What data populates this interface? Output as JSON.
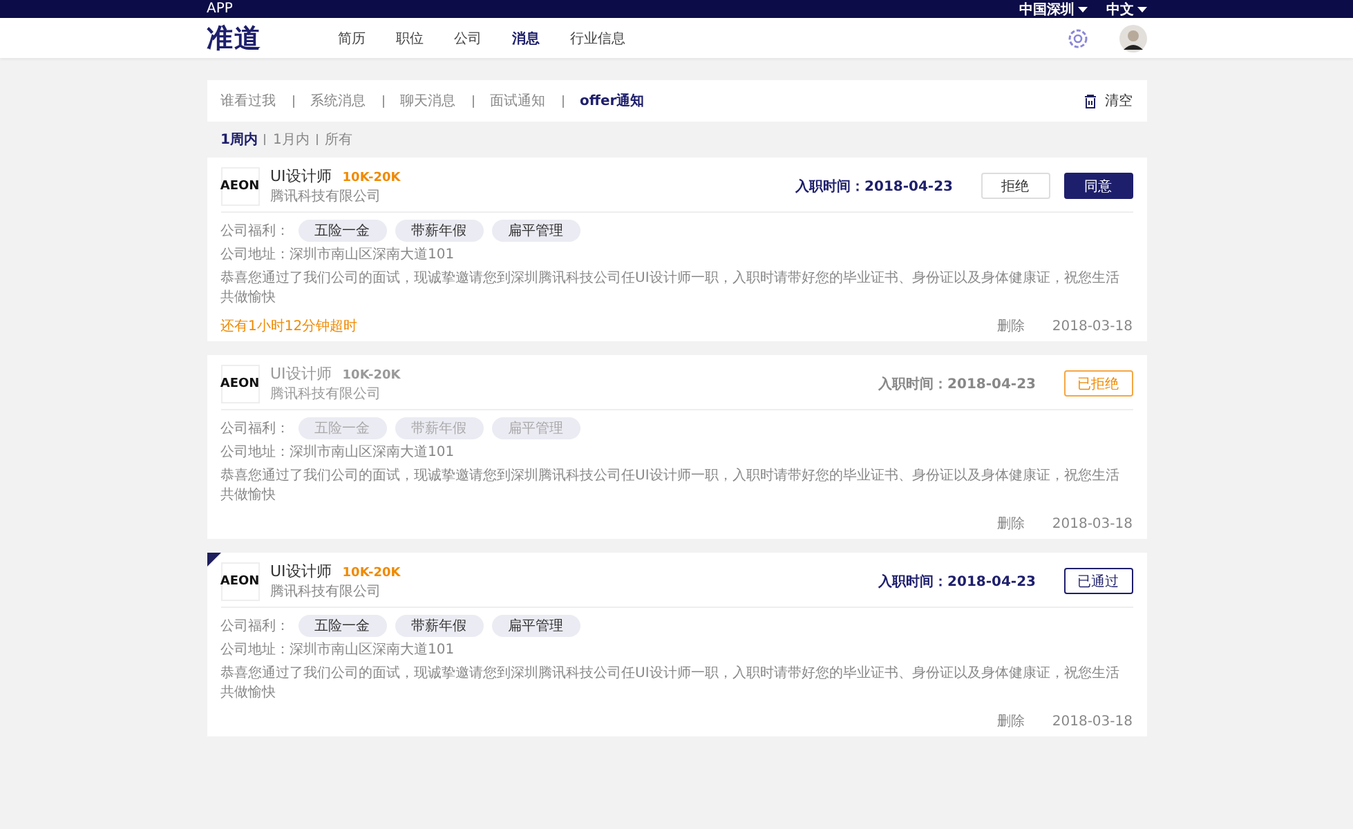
{
  "top_bar": {
    "app_label": "APP",
    "location": "中国深圳",
    "language": "中文"
  },
  "header": {
    "logo": "准道",
    "nav": [
      {
        "label": "简历",
        "selected": false
      },
      {
        "label": "职位",
        "selected": false
      },
      {
        "label": "公司",
        "selected": false
      },
      {
        "label": "消息",
        "selected": true
      },
      {
        "label": "行业信息",
        "selected": false
      }
    ]
  },
  "message_tabs": [
    {
      "label": "谁看过我",
      "selected": false
    },
    {
      "label": "系统消息",
      "selected": false
    },
    {
      "label": "聊天消息",
      "selected": false
    },
    {
      "label": "面试通知",
      "selected": false
    },
    {
      "label": "offer通知",
      "selected": true
    }
  ],
  "clear_label": "清空",
  "time_filters": [
    {
      "label": "1周内",
      "selected": true
    },
    {
      "label": "1月内",
      "selected": false
    },
    {
      "label": "所有",
      "selected": false
    }
  ],
  "offers": [
    {
      "logo": "AEON",
      "title": "UI设计师",
      "salary": "10K-20K",
      "company": "腾讯科技有限公司",
      "start_date": "入职时间：2018-04-23",
      "faded": false,
      "flagged": false,
      "kind": "pending",
      "actions": [
        "拒绝",
        "同意"
      ],
      "benefits_label": "公司福利：",
      "benefits": [
        "五险一金",
        "带薪年假",
        "扁平管理"
      ],
      "address": "公司地址：深圳市南山区深南大道101",
      "message": "恭喜您通过了我们公司的面试，现诚挚邀请您到深圳腾讯科技公司任UI设计师一职，入职时请带好您的毕业证书、身份证以及身体健康证，祝您生活共做愉快",
      "countdown": "还有1小时12分钟超时",
      "delete_label": "删除",
      "date": "2018-03-18"
    },
    {
      "logo": "AEON",
      "title": "UI设计师",
      "salary": "10K-20K",
      "company": "腾讯科技有限公司",
      "start_date": "入职时间：2018-04-23",
      "faded": true,
      "flagged": false,
      "kind": "rejected",
      "actions": [
        "已拒绝"
      ],
      "benefits_label": "公司福利：",
      "benefits": [
        "五险一金",
        "带薪年假",
        "扁平管理"
      ],
      "address": "公司地址：深圳市南山区深南大道101",
      "message": "恭喜您通过了我们公司的面试，现诚挚邀请您到深圳腾讯科技公司任UI设计师一职，入职时请带好您的毕业证书、身份证以及身体健康证，祝您生活共做愉快",
      "delete_label": "删除",
      "date": "2018-03-18"
    },
    {
      "logo": "AEON",
      "title": "UI设计师",
      "salary": "10K-20K",
      "company": "腾讯科技有限公司",
      "start_date": "入职时间：2018-04-23",
      "faded": false,
      "flagged": true,
      "kind": "accepted",
      "actions": [
        "已通过"
      ],
      "benefits_label": "公司福利：",
      "benefits": [
        "五险一金",
        "带薪年假",
        "扁平管理"
      ],
      "address": "公司地址：深圳市南山区深南大道101",
      "message": "恭喜您通过了我们公司的面试，现诚挚邀请您到深圳腾讯科技公司任UI设计师一职，入职时请带好您的毕业证书、身份证以及身体健康证，祝您生活共做愉快",
      "delete_label": "删除",
      "date": "2018-03-18"
    }
  ]
}
